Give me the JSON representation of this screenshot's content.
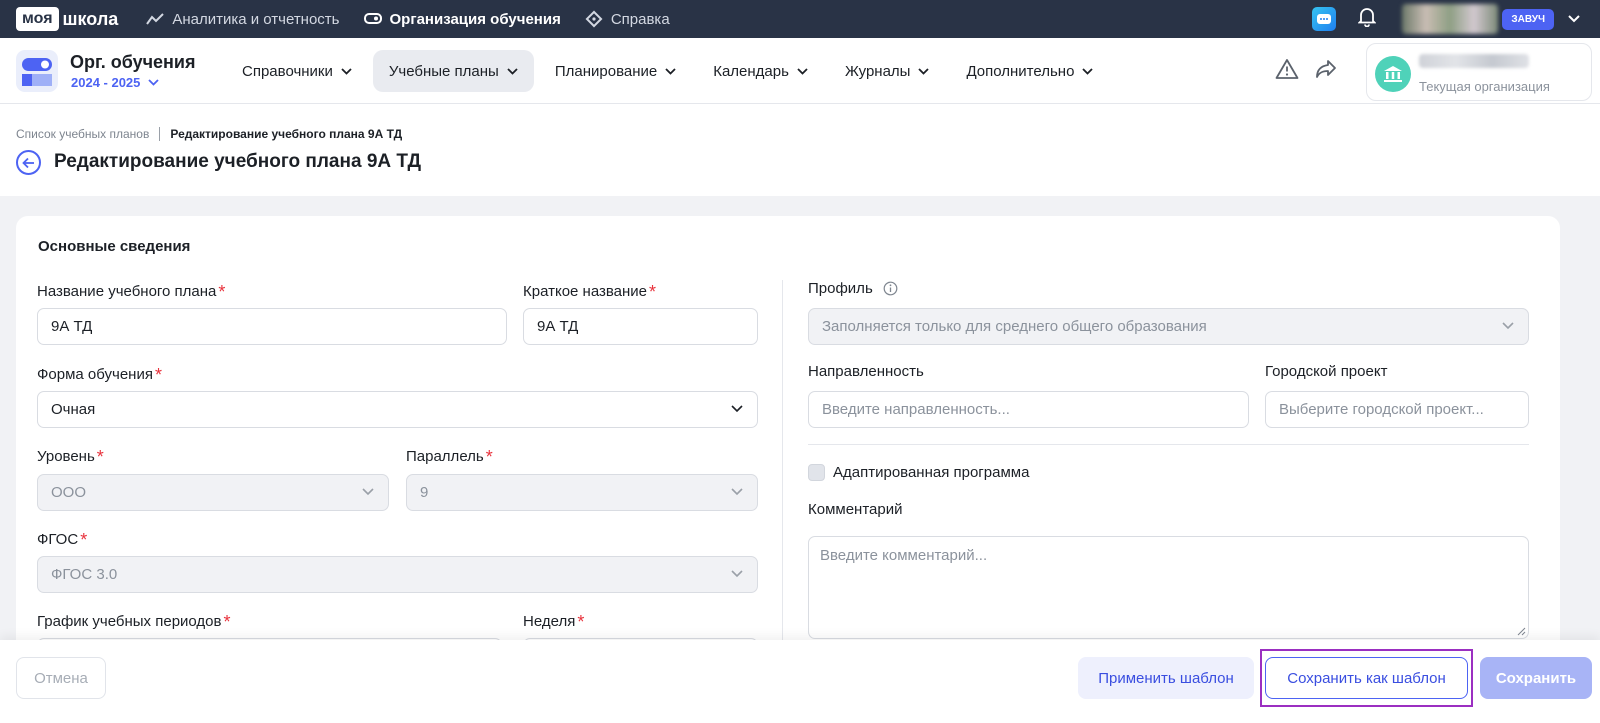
{
  "brand": {
    "box": "моя",
    "text": "школа"
  },
  "top_nav": [
    {
      "label": "Аналитика и отчетность",
      "icon": "analytics-icon",
      "active": false
    },
    {
      "label": "Организация обучения",
      "icon": "organization-icon",
      "active": true
    },
    {
      "label": "Справка",
      "icon": "help-icon",
      "active": false
    }
  ],
  "user": {
    "role": "ЗАВУЧ"
  },
  "org": {
    "title": "Орг. обучения",
    "year": "2024 - 2025"
  },
  "main_nav": [
    {
      "label": "Справочники",
      "active": false
    },
    {
      "label": "Учебные планы",
      "active": true
    },
    {
      "label": "Планирование",
      "active": false
    },
    {
      "label": "Календарь",
      "active": false
    },
    {
      "label": "Журналы",
      "active": false
    },
    {
      "label": "Дополнительно",
      "active": false
    }
  ],
  "current_org": {
    "label": "Текущая организация"
  },
  "breadcrumb": {
    "parent": "Список учебных планов",
    "current": "Редактирование учебного плана 9А ТД"
  },
  "page_title": "Редактирование учебного плана 9А ТД",
  "form": {
    "section_title": "Основные сведения",
    "plan_name": {
      "label": "Название учебного плана",
      "value": "9А ТД"
    },
    "short_name": {
      "label": "Краткое название",
      "value": "9А ТД"
    },
    "study_form": {
      "label": "Форма обучения",
      "value": "Очная"
    },
    "level": {
      "label": "Уровень",
      "value": "ООО"
    },
    "parallel": {
      "label": "Параллель",
      "value": "9"
    },
    "fgos": {
      "label": "ФГОС",
      "value": "ФГОС 3.0"
    },
    "schedule": {
      "label": "График учебных периодов"
    },
    "week": {
      "label": "Неделя"
    },
    "profile": {
      "label": "Профиль",
      "placeholder": "Заполняется только для среднего общего образования"
    },
    "direction": {
      "label": "Направленность",
      "placeholder": "Введите направленность..."
    },
    "city_project": {
      "label": "Городской проект",
      "placeholder": "Выберите городской проект..."
    },
    "adapted": {
      "label": "Адаптированная программа",
      "checked": false
    },
    "comment": {
      "label": "Комментарий",
      "placeholder": "Введите комментарий..."
    }
  },
  "footer": {
    "cancel": "Отмена",
    "apply_template": "Применить шаблон",
    "save_as_template": "Сохранить как шаблон",
    "save": "Сохранить"
  },
  "colors": {
    "accent": "#4d63f3",
    "topbar": "#293346",
    "required": "#e8323c",
    "highlight": "#9b2fc1"
  }
}
